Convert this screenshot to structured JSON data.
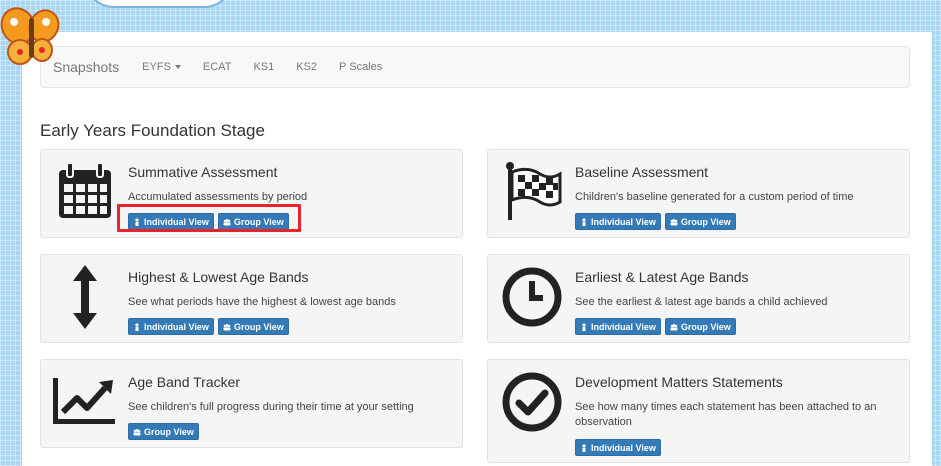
{
  "navbar": {
    "brand": "Snapshots",
    "items": [
      "EYFS",
      "ECAT",
      "KS1",
      "KS2",
      "P Scales"
    ]
  },
  "heading": "Early Years Foundation Stage",
  "cards": [
    {
      "title": "Summative Assessment",
      "desc": "Accumulated assessments by period",
      "icon": "calendar-icon",
      "buttons": [
        "Individual View",
        "Group View"
      ]
    },
    {
      "title": "Baseline Assessment",
      "desc": "Children's baseline generated for a custom period of time",
      "icon": "flag-checkered-icon",
      "buttons": [
        "Individual View",
        "Group View"
      ]
    },
    {
      "title": "Highest & Lowest Age Bands",
      "desc": "See what periods have the highest & lowest age bands",
      "icon": "vertical-arrows-icon",
      "buttons": [
        "Individual View",
        "Group View"
      ]
    },
    {
      "title": "Earliest & Latest Age Bands",
      "desc": "See the earliest & latest age bands a child achieved",
      "icon": "clock-icon",
      "buttons": [
        "Individual View",
        "Group View"
      ]
    },
    {
      "title": "Age Band Tracker",
      "desc": "See children's full progress during their time at your setting",
      "icon": "line-chart-icon",
      "buttons": [
        "Group View"
      ]
    },
    {
      "title": "Development Matters Statements",
      "desc": "See how many times each statement has been attached to an observation",
      "icon": "check-circle-icon",
      "buttons": [
        "Individual View"
      ]
    }
  ],
  "colors": {
    "primary": "#337ab7",
    "highlight": "#e8232a",
    "background": "#a9d6f0"
  }
}
